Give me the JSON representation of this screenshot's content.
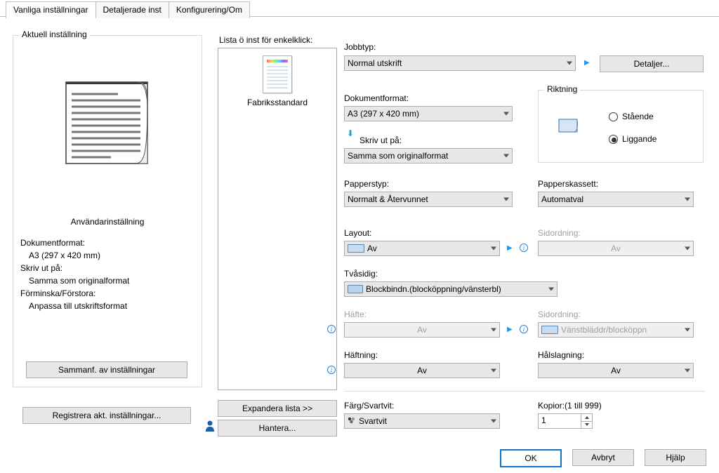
{
  "tabs": {
    "t0": "Vanliga inställningar",
    "t1": "Detaljerade inst",
    "t2": "Konfigurering/Om"
  },
  "group_current": {
    "legend": "Aktuell inställning",
    "user_title": "Användarinställning",
    "docformat_lbl": "Dokumentformat:",
    "docformat_val": "A3 (297 x 420 mm)",
    "printon_lbl": "Skriv ut på:",
    "printon_val": "Samma som originalformat",
    "scale_lbl": "Förminska/Förstora:",
    "scale_val": "Anpassa till utskriftsformat",
    "summary_btn": "Sammanf. av inställningar"
  },
  "register_btn": "Registrera akt. inställningar...",
  "list": {
    "label": "Lista ö inst för enkelklick:",
    "item0": "Fabriksstandard",
    "expand": "Expandera lista >>",
    "manage": "Hantera..."
  },
  "right": {
    "jobtype_lbl": "Jobbtyp:",
    "jobtype_val": "Normal utskrift",
    "details_btn": "Detaljer...",
    "docformat_lbl": "Dokumentformat:",
    "docformat_val": "A3 (297 x 420 mm)",
    "printon_lbl": "Skriv ut på:",
    "printon_val": "Samma som originalformat",
    "dir_legend": "Riktning",
    "dir_port": "Stående",
    "dir_land": "Liggande",
    "paptype_lbl": "Papperstyp:",
    "paptype_val": "Normalt & Återvunnet",
    "tray_lbl": "Papperskassett:",
    "tray_val": "Automatval",
    "layout_lbl": "Layout:",
    "layout_val": "Av",
    "pageorder_lbl": "Sidordning:",
    "pageorder_val": "Av",
    "duplex_lbl": "Tvåsidig:",
    "duplex_val": "Blockbindn.(blocköppning/vänsterbl)",
    "booklet_lbl": "Häfte:",
    "booklet_val": "Av",
    "pageorder2_lbl": "Sidordning:",
    "pageorder2_val": "Vänstbläddr/blocköppn",
    "staple_lbl": "Häftning:",
    "staple_val": "Av",
    "punch_lbl": "Hålslagning:",
    "punch_val": "Av",
    "color_lbl": "Färg/Svartvit:",
    "color_val": "Svartvit",
    "copies_lbl": "Kopior:(1 till 999)",
    "copies_val": "1"
  },
  "footer": {
    "ok": "OK",
    "cancel": "Avbryt",
    "help": "Hjälp"
  }
}
